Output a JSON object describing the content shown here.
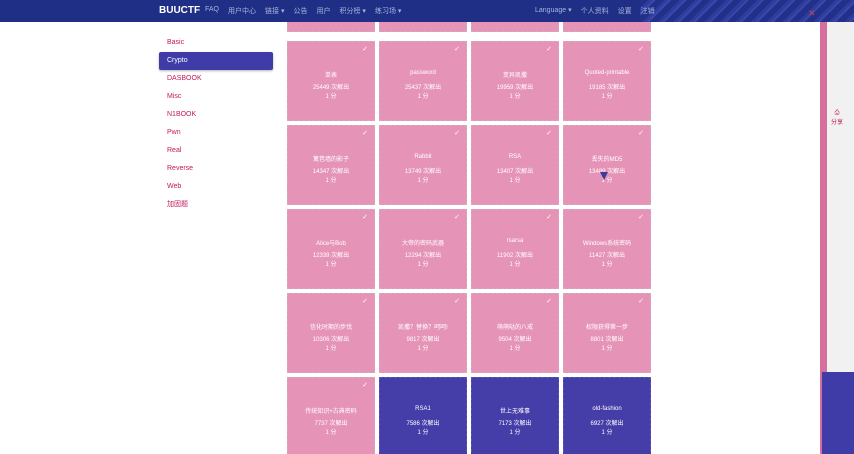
{
  "navbar": {
    "brand": "BUUCTF",
    "left_links": [
      "FAQ",
      "用户中心",
      "链接 ▾",
      "公告",
      "用户",
      "积分榜 ▾",
      "练习场 ▾"
    ],
    "right_links": [
      "Language ▾",
      "个人资料",
      "设置",
      "注销"
    ]
  },
  "sidebar": {
    "items": [
      {
        "label": "Basic",
        "active": false
      },
      {
        "label": "Crypto",
        "active": true
      },
      {
        "label": "DASBOOK",
        "active": false
      },
      {
        "label": "Misc",
        "active": false
      },
      {
        "label": "N1BOOK",
        "active": false
      },
      {
        "label": "Pwn",
        "active": false
      },
      {
        "label": "Real",
        "active": false
      },
      {
        "label": "Reverse",
        "active": false
      },
      {
        "label": "Web",
        "active": false
      },
      {
        "label": "加固题",
        "active": false
      }
    ]
  },
  "challenges": [
    {
      "name": "",
      "count": "",
      "score": "",
      "style": "pink",
      "check": true
    },
    {
      "name": "",
      "count": "",
      "score": "",
      "style": "pink",
      "check": true
    },
    {
      "name": "",
      "count": "",
      "score": "",
      "style": "pink",
      "check": true
    },
    {
      "name": "",
      "count": "",
      "score": "",
      "style": "pink",
      "check": true
    },
    {
      "name": "单表",
      "count": "25449 次解出",
      "score": "1 分",
      "style": "pink",
      "check": true
    },
    {
      "name": "password",
      "count": "25437 次解出",
      "score": "1 分",
      "style": "pink",
      "check": true
    },
    {
      "name": "变异凯撒",
      "count": "19959 次解出",
      "score": "1 分",
      "style": "pink",
      "check": true
    },
    {
      "name": "Quoted-printable",
      "count": "19185 次解出",
      "score": "1 分",
      "style": "pink",
      "check": true
    },
    {
      "name": "篱笆墙的影子",
      "count": "14347 次解出",
      "score": "1 分",
      "style": "pink",
      "check": true
    },
    {
      "name": "Rabbit",
      "count": "13749 次解出",
      "score": "1 分",
      "style": "pink",
      "check": true
    },
    {
      "name": "RSA",
      "count": "13407 次解出",
      "score": "1 分",
      "style": "pink",
      "check": true
    },
    {
      "name": "丢失的MD5",
      "count": "13489 次解出",
      "score": "1 分",
      "style": "pink",
      "check": true
    },
    {
      "name": "Alice与Bob",
      "count": "12339 次解出",
      "score": "1 分",
      "style": "pink",
      "check": true
    },
    {
      "name": "大帝的密码武器",
      "count": "12294 次解出",
      "score": "1 分",
      "style": "pink",
      "check": true
    },
    {
      "name": "rsarsa",
      "count": "11902 次解出",
      "score": "1 分",
      "style": "pink",
      "check": true
    },
    {
      "name": "Windows系统密码",
      "count": "11427 次解出",
      "score": "1 分",
      "style": "pink",
      "check": true
    },
    {
      "name": "信化时期的步伐",
      "count": "10306 次解出",
      "score": "1 分",
      "style": "pink",
      "check": true
    },
    {
      "name": "凯撒？替换？呵呵!",
      "count": "9817 次解出",
      "score": "1 分",
      "style": "pink",
      "check": true
    },
    {
      "name": "萌萌哒的八戒",
      "count": "9504 次解出",
      "score": "1 分",
      "style": "pink",
      "check": true
    },
    {
      "name": "权限获得第一步",
      "count": "8801 次解出",
      "score": "1 分",
      "style": "pink",
      "check": true
    },
    {
      "name": "传统知识+古典密码",
      "count": "7737 次解出",
      "score": "1 分",
      "style": "pink",
      "check": true
    },
    {
      "name": "RSA1",
      "count": "7586 次解出",
      "score": "1 分",
      "style": "blue",
      "check": false
    },
    {
      "name": "世上无难事",
      "count": "7173 次解出",
      "score": "1 分",
      "style": "blue",
      "check": false
    },
    {
      "name": "old-fashion",
      "count": "6927 次解出",
      "score": "1 分",
      "style": "blue",
      "check": false
    }
  ],
  "right_panel": {
    "share_label": "分享"
  },
  "colors": {
    "navbar": "#1f2f86",
    "pink_tile": "#e594b8",
    "blue_tile": "#463ea8",
    "accent": "#c2185b"
  }
}
